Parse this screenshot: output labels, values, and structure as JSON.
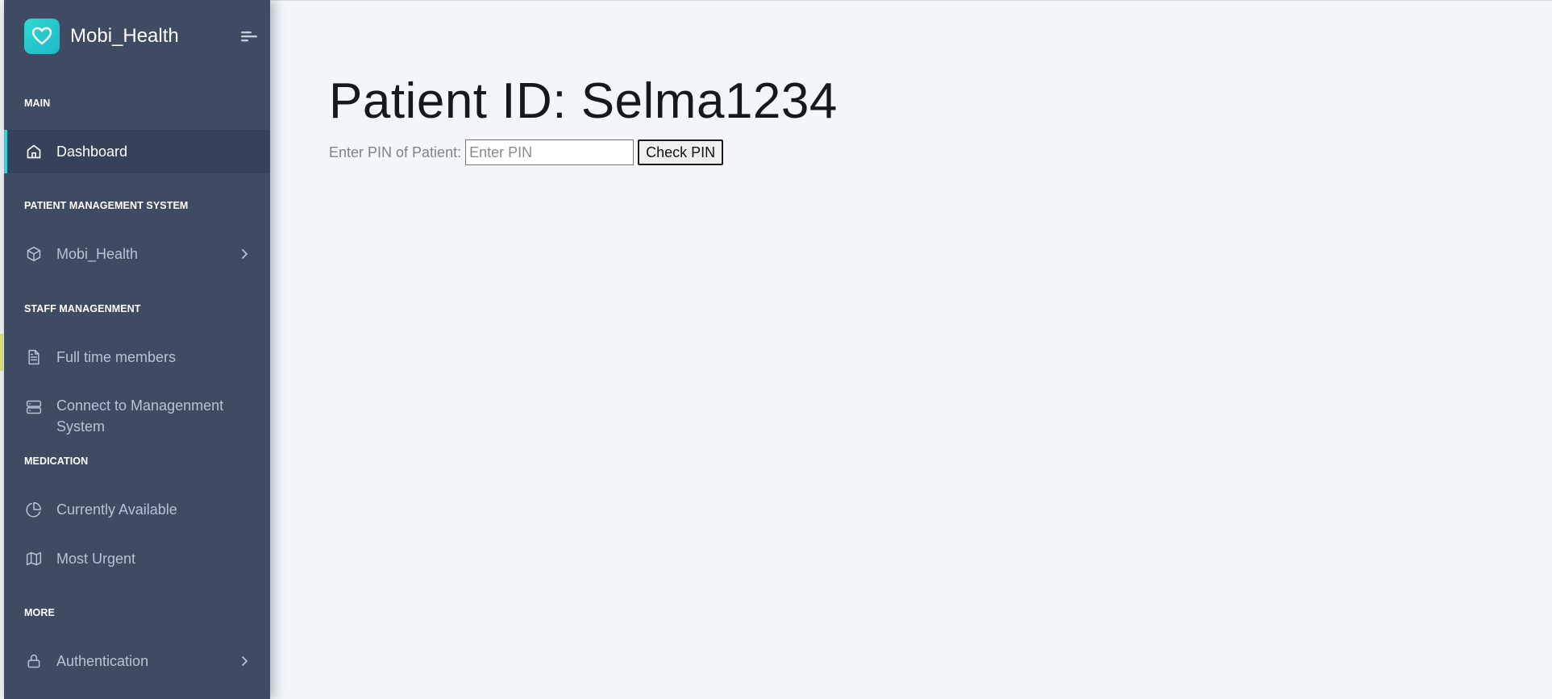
{
  "app": {
    "name": "Mobi_Health",
    "accent": "#2fd2d8",
    "sidebar_bg": "#3f4b63"
  },
  "sidebar": {
    "sections": {
      "main": "MAIN",
      "pms": "PATIENT MANAGEMENT SYSTEM",
      "staff": "STAFF MANAGENMENT",
      "medication": "MEDICATION",
      "more": "MORE"
    },
    "items": [
      {
        "label": "Dashboard",
        "icon": "home-icon",
        "active": true
      },
      {
        "label": "Mobi_Health",
        "icon": "cube-icon"
      },
      {
        "label": "Full time members",
        "icon": "document-icon"
      },
      {
        "label": "Connect to Managenment System",
        "icon": "server-icon"
      },
      {
        "label": "Currently Available",
        "icon": "pie-chart-icon"
      },
      {
        "label": "Most Urgent",
        "icon": "map-icon"
      },
      {
        "label": "Authentication",
        "icon": "lock-icon"
      }
    ]
  },
  "main": {
    "title": "Patient ID: Selma1234",
    "pin_label": "Enter PIN of Patient:",
    "pin_placeholder": "Enter PIN",
    "pin_value": "",
    "check_button": "Check PIN"
  }
}
